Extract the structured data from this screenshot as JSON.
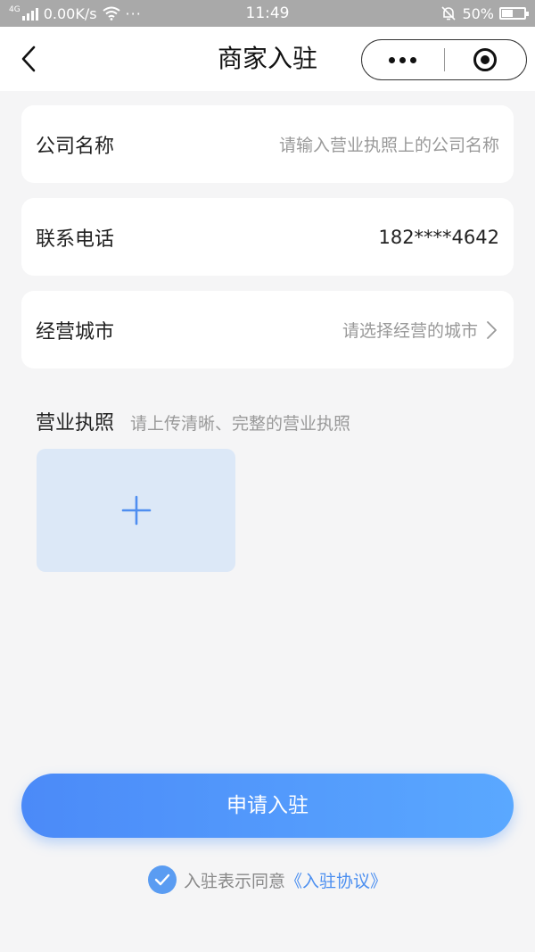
{
  "status_bar": {
    "network": "4G",
    "speed": "0.00K/s",
    "more": "···",
    "time": "11:49",
    "battery": "50%",
    "battery_level": 0.5
  },
  "nav": {
    "title": "商家入驻"
  },
  "form": {
    "company": {
      "label": "公司名称",
      "placeholder": "请输入营业执照上的公司名称"
    },
    "phone": {
      "label": "联系电话",
      "value": "182****4642"
    },
    "city": {
      "label": "经营城市",
      "placeholder": "请选择经营的城市"
    },
    "license": {
      "label": "营业执照",
      "hint": "请上传清晰、完整的营业执照"
    }
  },
  "submit_label": "申请入驻",
  "agreement": {
    "text": "入驻表示同意",
    "link": "《入驻协议》"
  },
  "colors": {
    "accent": "#4a8ef0",
    "upload_bg": "#dce8f7",
    "page_bg": "#f5f5f6"
  }
}
